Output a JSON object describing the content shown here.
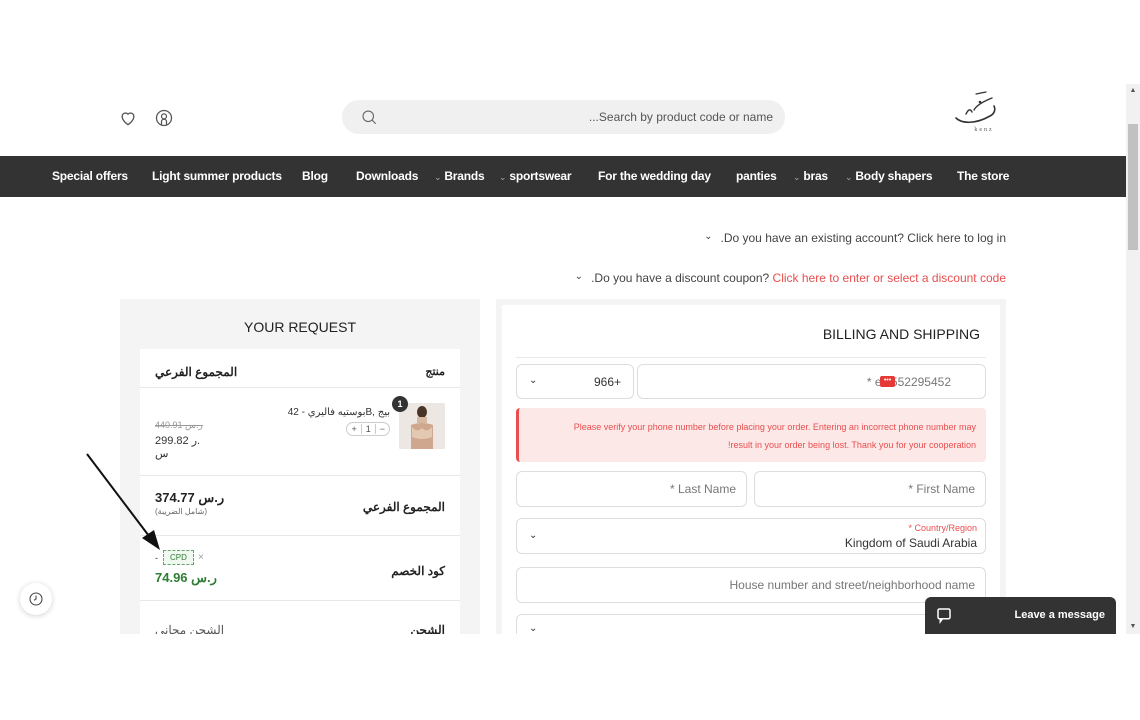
{
  "header": {
    "search_placeholder": "...Search by product code or name",
    "icons": [
      "heart-icon",
      "user-icon",
      "search-icon"
    ],
    "logo_text": "kenz"
  },
  "nav": {
    "items": [
      {
        "label": "Special offers",
        "dropdown": false
      },
      {
        "label": "Light summer products",
        "dropdown": false
      },
      {
        "label": "Blog",
        "dropdown": false
      },
      {
        "label": "Downloads",
        "dropdown": false
      },
      {
        "label": "Brands",
        "dropdown": true
      },
      {
        "label": "sportswear",
        "dropdown": true
      },
      {
        "label": "For the wedding day",
        "dropdown": false
      },
      {
        "label": "panties",
        "dropdown": false
      },
      {
        "label": "bras",
        "dropdown": true
      },
      {
        "label": "Body shapers",
        "dropdown": true
      },
      {
        "label": "The store",
        "dropdown": false
      }
    ]
  },
  "notices": {
    "login_text": ".Do you have an existing account? Click here to log in",
    "coupon_text": ".Do you have a discount coupon? ",
    "coupon_link": "Click here to enter or select a discount code"
  },
  "order": {
    "title": "YOUR REQUEST",
    "col_product": "منتج",
    "col_subtotal": "المجموع الفرعي",
    "item": {
      "name": "بوستيه فاليري - 42B, بيج",
      "qty_badge": "1",
      "qty_value": "1",
      "qty_plus": "+",
      "qty_minus": "−",
      "old_price": "440.91 ر.س",
      "new_price_line1": "299.82 ر.",
      "new_price_line2": "س"
    },
    "subtotal_label": "المجموع الفرعي",
    "subtotal_value": "374.77 ر.س",
    "subtotal_note": "(شامل الضريبة)",
    "discount_label": "كود الخصم",
    "discount_code": "CPD",
    "discount_remove": "×",
    "discount_dash": "-",
    "discount_value": "74.96 ر.س",
    "shipping_label": "الشحن",
    "shipping_value": "الشحن مجاني"
  },
  "billing": {
    "title": "BILLING AND SHIPPING",
    "country_code": "966+",
    "phone_placeholder": "* ex:552295452",
    "warning_line1": "Please verify your phone number before placing your order. Entering an incorrect phone number may",
    "warning_line2": "!result in your order being lost. Thank you for your cooperation",
    "last_name_placeholder": "* Last Name",
    "first_name_placeholder": "* First Name",
    "country_label": "* Country/Region",
    "country_value": "Kingdom of Saudi Arabia",
    "address_placeholder": "House number and street/neighborhood name"
  },
  "chat": {
    "label": "Leave a message"
  },
  "colors": {
    "nav_bg": "#333333",
    "link": "#e94e4e",
    "discount_green": "#2e7d32",
    "panel_bg": "#f4f4f4",
    "warn_bg": "#fde8e8"
  }
}
